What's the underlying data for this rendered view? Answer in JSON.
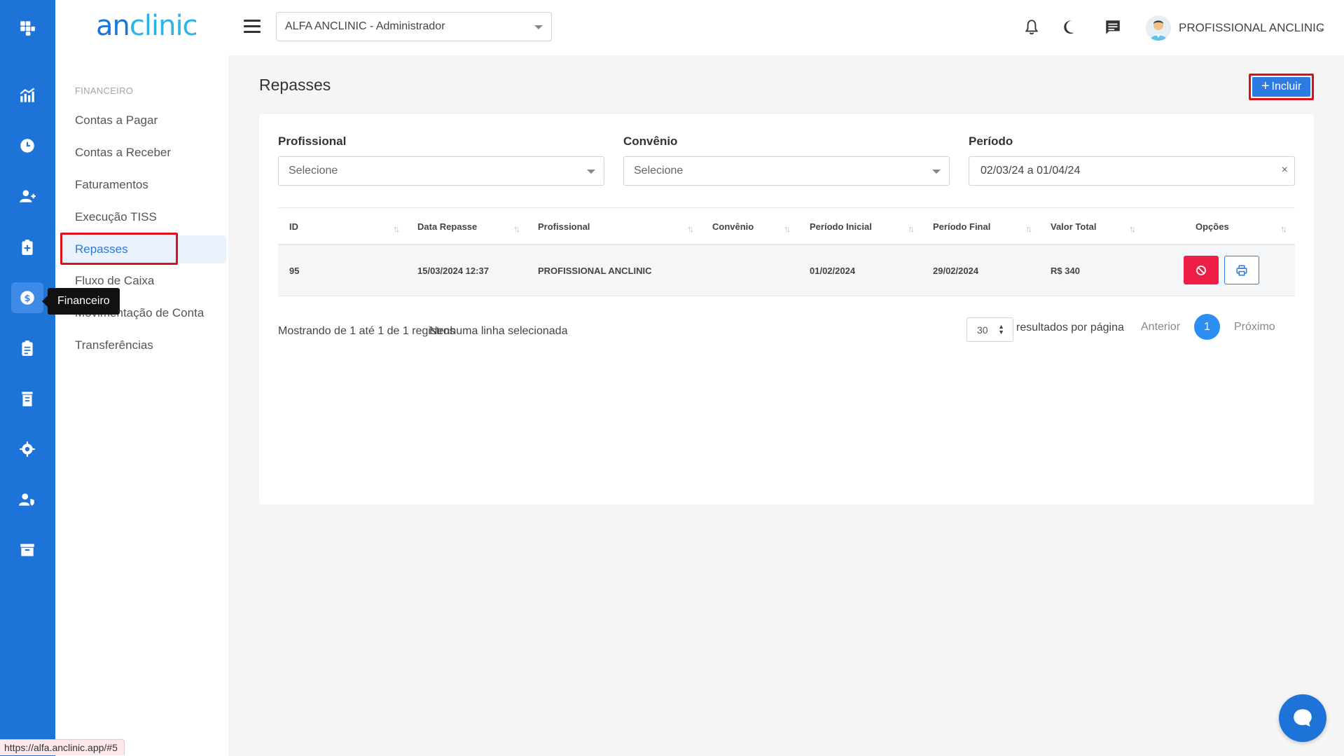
{
  "rail": {
    "tooltip": "Financeiro",
    "items": [
      "dashboard-icon",
      "clock-icon",
      "add-user-icon",
      "medical-clipboard-icon",
      "money-icon",
      "clipboard-icon",
      "receipt-icon",
      "gear-icon",
      "user-shield-icon",
      "archive-icon"
    ]
  },
  "menu": {
    "logo_prefix": "an",
    "logo_suffix": "clinic",
    "section": "FINANCEIRO",
    "items": [
      {
        "label": "Contas a Pagar"
      },
      {
        "label": "Contas a Receber"
      },
      {
        "label": "Faturamentos"
      },
      {
        "label": "Execução TISS"
      },
      {
        "label": "Repasses"
      },
      {
        "label": "Fluxo de Caixa"
      },
      {
        "label": "Movimentação de Conta"
      },
      {
        "label": "Transferências"
      }
    ]
  },
  "header": {
    "org_select": "ALFA ANCLINIC - Administrador",
    "user_name": "PROFISSIONAL ANCLINIC",
    "user_caret": "⌄"
  },
  "page": {
    "title": "Repasses",
    "add_button": "Incluir",
    "add_icon": "+"
  },
  "filters": {
    "profissional_label": "Profissional",
    "profissional_placeholder": "Selecione",
    "convenio_label": "Convênio",
    "convenio_placeholder": "Selecione",
    "periodo_label": "Período",
    "periodo_value": "02/03/24 a 01/04/24",
    "clear": "×"
  },
  "table": {
    "columns": [
      "ID",
      "Data Repasse",
      "Profissional",
      "Convênio",
      "Período Inicial",
      "Período Final",
      "Valor Total",
      "Opções"
    ],
    "sort_glyph": "↑↓",
    "rows": [
      {
        "id": "95",
        "data_repasse": "15/03/2024 12:37",
        "profissional": "PROFISSIONAL ANCLINIC",
        "convenio": "",
        "periodo_inicial": "01/02/2024",
        "periodo_final": "29/02/2024",
        "valor_total": "R$ 340"
      }
    ]
  },
  "footer": {
    "showing": "Mostrando de 1 até 1 de 1 registros",
    "selected": "Nenhuma linha selecionada",
    "per_page_value": "30",
    "per_page_label": "resultados por página",
    "prev": "Anterior",
    "current_page": "1",
    "next": "Próximo"
  },
  "status_url": "https://alfa.anclinic.app/#5",
  "colors": {
    "rail": "#1e73d8",
    "primary": "#2d7be0",
    "danger": "#ee1f46",
    "highlight_outline": "#e0101b"
  }
}
